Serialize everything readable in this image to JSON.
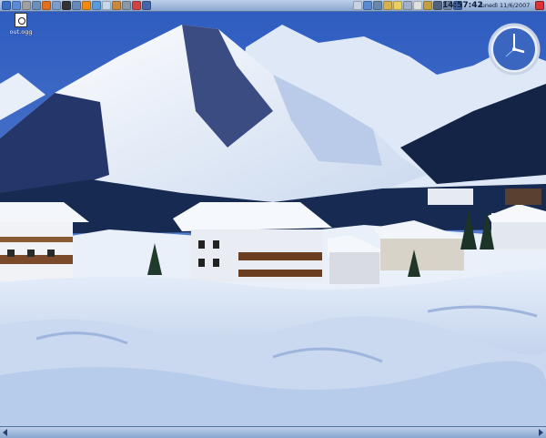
{
  "top_panel": {
    "launchers": [
      {
        "icon": "main-menu-icon",
        "color": "#3a6fc4"
      },
      {
        "icon": "desktop-icon",
        "color": "#5b8ad6"
      },
      {
        "icon": "tool-icon",
        "color": "#a0a0a0"
      },
      {
        "icon": "info-icon",
        "color": "#6d8fb8"
      },
      {
        "icon": "firefox-icon",
        "color": "#e07020"
      },
      {
        "icon": "settings-icon",
        "color": "#7c9ccc"
      },
      {
        "icon": "terminal-icon",
        "color": "#333333"
      },
      {
        "icon": "file-manager-icon",
        "color": "#6688bb"
      },
      {
        "icon": "vlc-icon",
        "color": "#f08a10"
      },
      {
        "icon": "chat-icon",
        "color": "#5a9ad8"
      },
      {
        "icon": "image-icon",
        "color": "#c8d8e8"
      },
      {
        "icon": "package-icon",
        "color": "#c88a3a"
      },
      {
        "icon": "calculator-icon",
        "color": "#889aaa"
      },
      {
        "icon": "pen-icon",
        "color": "#cc4444"
      },
      {
        "icon": "network-icon",
        "color": "#4466aa"
      }
    ],
    "tray_icons": [
      {
        "icon": "notes-icon",
        "color": "#c8d4e4"
      },
      {
        "icon": "sync-icon",
        "color": "#5a8ad0"
      },
      {
        "icon": "mail-icon",
        "color": "#6688aa"
      },
      {
        "icon": "folder-icon",
        "color": "#d8b050"
      },
      {
        "icon": "bookmark-icon",
        "color": "#e8d060"
      },
      {
        "icon": "window-icon",
        "color": "#a0b0c8"
      },
      {
        "icon": "clipboard-icon",
        "color": "#e0e0e0"
      },
      {
        "icon": "battery-icon",
        "color": "#c0a040"
      },
      {
        "icon": "volume-icon",
        "color": "#506080"
      },
      {
        "icon": "network-status-icon",
        "color": "#7080a0"
      },
      {
        "icon": "time-zone-icon",
        "color": "#4060a0"
      }
    ],
    "clock_time": "14:57:42",
    "clock_date": "lunedì 11/6/2007"
  },
  "desktop": {
    "icons": [
      {
        "label": "out.ogg",
        "icon": "audio-file-icon"
      }
    ]
  },
  "colors": {
    "panel": "#9fb8dc",
    "sky": "#4a72c0",
    "snow": "#eef3fb"
  }
}
